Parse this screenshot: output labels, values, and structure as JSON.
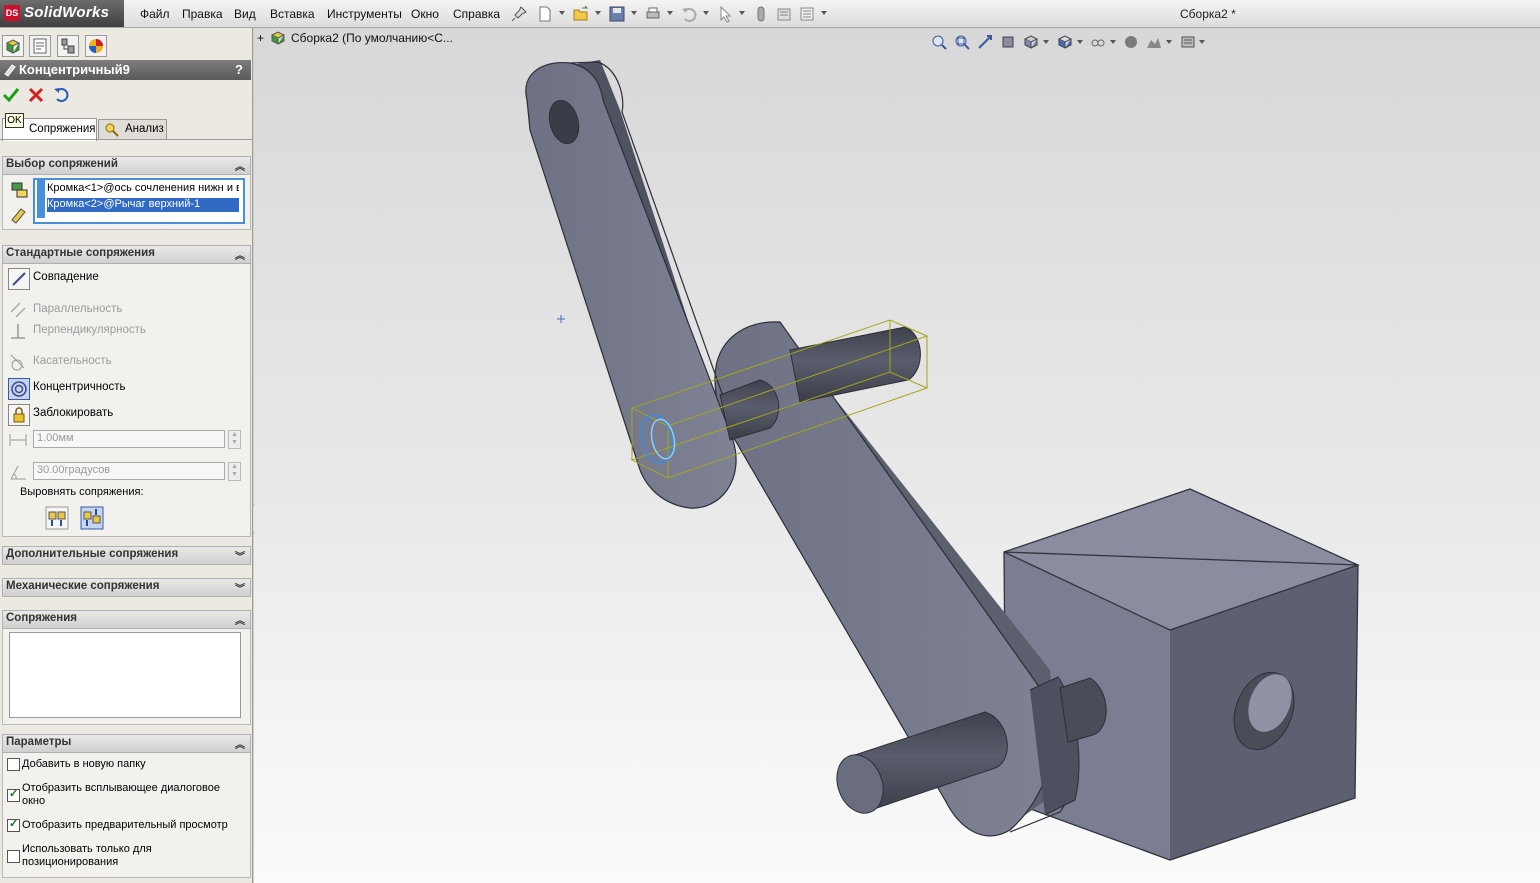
{
  "app": {
    "brand": "SolidWorks",
    "ds_logo": "DS",
    "document_title": "Сборка2 *"
  },
  "menu": [
    "Файл",
    "Правка",
    "Вид",
    "Вставка",
    "Инструменты",
    "Окно",
    "Справка"
  ],
  "toolbar_icons": [
    "pin-icon",
    "new-file-icon",
    "open-folder-icon",
    "save-icon",
    "print-icon",
    "undo-icon",
    "select-icon",
    "rebuild-icon",
    "file-properties-icon",
    "options-icon"
  ],
  "feature_tree": {
    "expander": "+",
    "root_label": "Сборка2  (По умолчанию<С..."
  },
  "property_manager": {
    "title": "Концентричный9",
    "help": "?",
    "tooltip": "OK",
    "tabs": [
      "Сопряжения",
      "Анализ"
    ],
    "mate_selection": {
      "header": "Выбор сопряжений",
      "items": [
        "Кромка<1>@ось сочленения нижн и в",
        "Кромка<2>@Рычаг верхний-1"
      ],
      "selected_index": 1
    },
    "standard_mates": {
      "header": "Стандартные сопряжения",
      "options": [
        {
          "label": "Совпадение",
          "icon": "coincident-icon",
          "enabled": true,
          "active": false
        },
        {
          "label": "Параллельность",
          "icon": "parallel-icon",
          "enabled": false,
          "active": false
        },
        {
          "label": "Перпендикулярность",
          "icon": "perpendicular-icon",
          "enabled": false,
          "active": false
        },
        {
          "label": "Касательность",
          "icon": "tangent-icon",
          "enabled": false,
          "active": false
        },
        {
          "label": "Концентричность",
          "icon": "concentric-icon",
          "enabled": true,
          "active": true
        },
        {
          "label": "Заблокировать",
          "icon": "lock-icon",
          "enabled": true,
          "active": false
        }
      ],
      "distance_value": "1.00мм",
      "angle_value": "30.00градусов",
      "align_label": "Выровнять сопряжения:"
    },
    "advanced_header": "Дополнительные сопряжения",
    "mechanical_header": "Механические сопряжения",
    "mates_header": "Сопряжения",
    "options": {
      "header": "Параметры",
      "checkboxes": [
        {
          "label": "Добавить в новую папку",
          "checked": false
        },
        {
          "label": "Отобразить всплывающее диалоговое окно",
          "checked": true
        },
        {
          "label": "Отобразить предварительный просмотр",
          "checked": true
        },
        {
          "label": "Использовать только для позиционирования",
          "checked": false
        }
      ]
    }
  },
  "view_toolbar_icons": [
    "zoom-to-fit-icon",
    "zoom-area-icon",
    "previous-view-icon",
    "section-view-icon",
    "view-orientation-icon",
    "display-style-icon",
    "hide-show-icon",
    "edit-appearance-icon",
    "apply-scene-icon",
    "view-settings-icon"
  ],
  "colors": {
    "part": "#7a7d8f",
    "part_dark": "#5a5c6b",
    "selection": "#2f8ff0",
    "bbox": "#a5a51a"
  }
}
